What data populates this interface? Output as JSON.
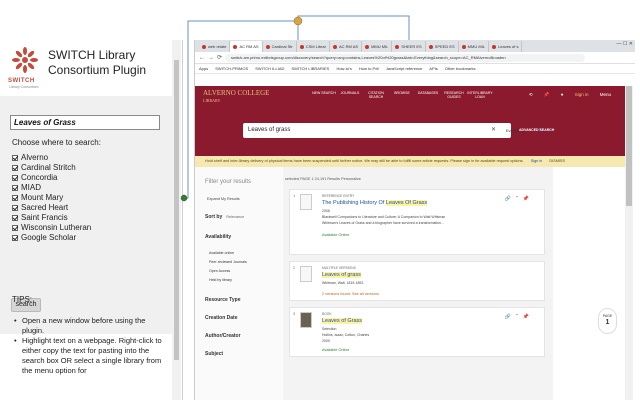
{
  "extension": {
    "title": "SWITCH Library Consortium Plugin",
    "logo_text": "SWITCH",
    "logo_subtext": "Library Consortium",
    "search_value": "Leaves of Grass",
    "choose_label": "Choose where to search:",
    "libraries": [
      "Alverno",
      "Cardinal Stritch",
      "Concordia",
      "MIAD",
      "Mount Mary",
      "Sacred Heart",
      "Saint Francis",
      "Wisconsin Lutheran",
      "Google Scholar"
    ],
    "search_button": "search",
    "tips_title": "TIPS:",
    "tips": [
      "Open a new window before using the plugin.",
      "Highlight text on a webpage. Right-click to either copy the text for pasting into the search box OR select a single library from the menu option for"
    ]
  },
  "browser": {
    "tabs": [
      "web relate",
      "AC RM AS",
      "Cardinal Str",
      "CSM Librar",
      "AC RM AS",
      "MMU MIL",
      "SHEER ES",
      "SPEED ES",
      "MMU MIL",
      "Leaves of s"
    ],
    "url": "switch-am.primo.exlibrisgroup.com/discovery/search?query=any,contains,Leaves%20of%20grass&tab=Everything&search_scope=AC_RMAlvernoBroaden",
    "bookmarks": [
      "Apps",
      "SWITCH-PRIMOS",
      "SWITCH ILLIAD",
      "SWITCH LIBRARIES",
      "How-to's",
      "How to Pdf",
      "JavaScript reference",
      "APIs",
      "Other bookmarks"
    ]
  },
  "primo": {
    "brand": "ALVERNO COLLEGE",
    "brand_sub": "LIBRARY",
    "nav": [
      "NEW SEARCH",
      "JOURNALS",
      "CITATION SEARCH",
      "BROWSE",
      "DATABASES",
      "RESEARCH GUIDES",
      "INTERLIBRARY LOAN"
    ],
    "signin": "Sign in",
    "menu": "Menu",
    "query": "Leaves of grass",
    "scope": "Everything",
    "advanced": "ADVANCED SEARCH",
    "notice": "Hold shelf and inter-library delivery of physical items have been suspended until further notice. We may still be able to fulfill some article requests. Please sign in for available request options.",
    "notice_signin": "Sign in",
    "notice_dismiss": "DISMISS",
    "filter_title": "Filter your results",
    "expand_label": "Expand My Results",
    "sort_label": "Sort by",
    "sort_value": "Relevance",
    "facet_availability": "Availability",
    "availability_items": [
      "Available online",
      "Peer-reviewed Journals",
      "Open Access",
      "Held by library"
    ],
    "facet_resource": "Resource Type",
    "facet_creation": "Creation Date",
    "facet_author": "Author/Creator",
    "facet_subject": "Subject",
    "results_header": "selected   PAGE 1   24,191 Results   Personalize",
    "results": [
      {
        "num": "1",
        "type": "REFERENCE ENTRY",
        "title_pre": "The Publishing History Of ",
        "title_hl": "Leaves Of Grass",
        "line1": "2006",
        "line2": "Blackwell Companions to Literature and Culture: A Companion to Walt Whitman",
        "line3": "Whitman's Leaves of Grass and a biographer have survived a transformation…",
        "avail": "Available Online"
      },
      {
        "num": "2",
        "type": "MULTIPLE VERSIONS",
        "title_pre": "",
        "title_hl": "Leaves of grass",
        "line1": "Whitman, Walt, 1819-1892.",
        "line2": "",
        "line3": "",
        "avail": "2 versions found. See all versions"
      },
      {
        "num": "3",
        "type": "BOOK",
        "title_pre": "",
        "title_hl": "Leaves of Grass",
        "line1": "Selection",
        "line2": "Hollins, Isaac; Cotton, Charles",
        "line3": "2000",
        "avail": "Available Online"
      }
    ],
    "page_label": "PAGE",
    "page_num": "1"
  }
}
